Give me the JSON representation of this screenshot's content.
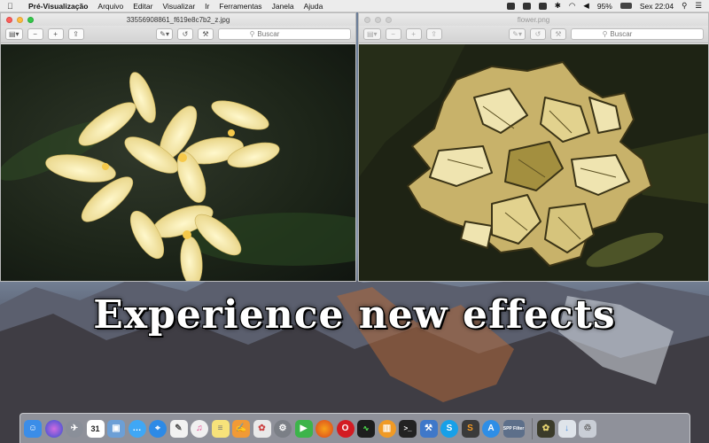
{
  "menubar": {
    "apple_icon": "apple-logo",
    "items": [
      "Pré-Visualização",
      "Arquivo",
      "Editar",
      "Visualizar",
      "Ir",
      "Ferramentas",
      "Janela",
      "Ajuda"
    ],
    "battery": "95%",
    "clock": "Sex 22:04"
  },
  "windows": {
    "left": {
      "title": "33556908861_f619e8c7b2_z.jpg",
      "search_placeholder": "Buscar"
    },
    "right": {
      "title": "flower.png",
      "search_placeholder": "Buscar"
    }
  },
  "headline": "Experience new effects",
  "dock": {
    "calendar_day": "31",
    "spp_filter_label": "SPP Filter",
    "items": [
      "finder",
      "siri",
      "launchpad",
      "calendar",
      "preview",
      "messages",
      "safari",
      "textedit",
      "itunes",
      "notes",
      "pages",
      "photos",
      "system-preferences",
      "facetime",
      "firefox",
      "opera",
      "activity-monitor",
      "books",
      "terminal",
      "xcode",
      "skype",
      "sublime",
      "app-store",
      "spp-filter",
      "trash"
    ]
  },
  "colors": {
    "close": "#fc605c",
    "minimize": "#fdbc40",
    "zoom": "#34c84a",
    "petal": "#f3e6a8",
    "effect_fill": "#c8b26a"
  }
}
